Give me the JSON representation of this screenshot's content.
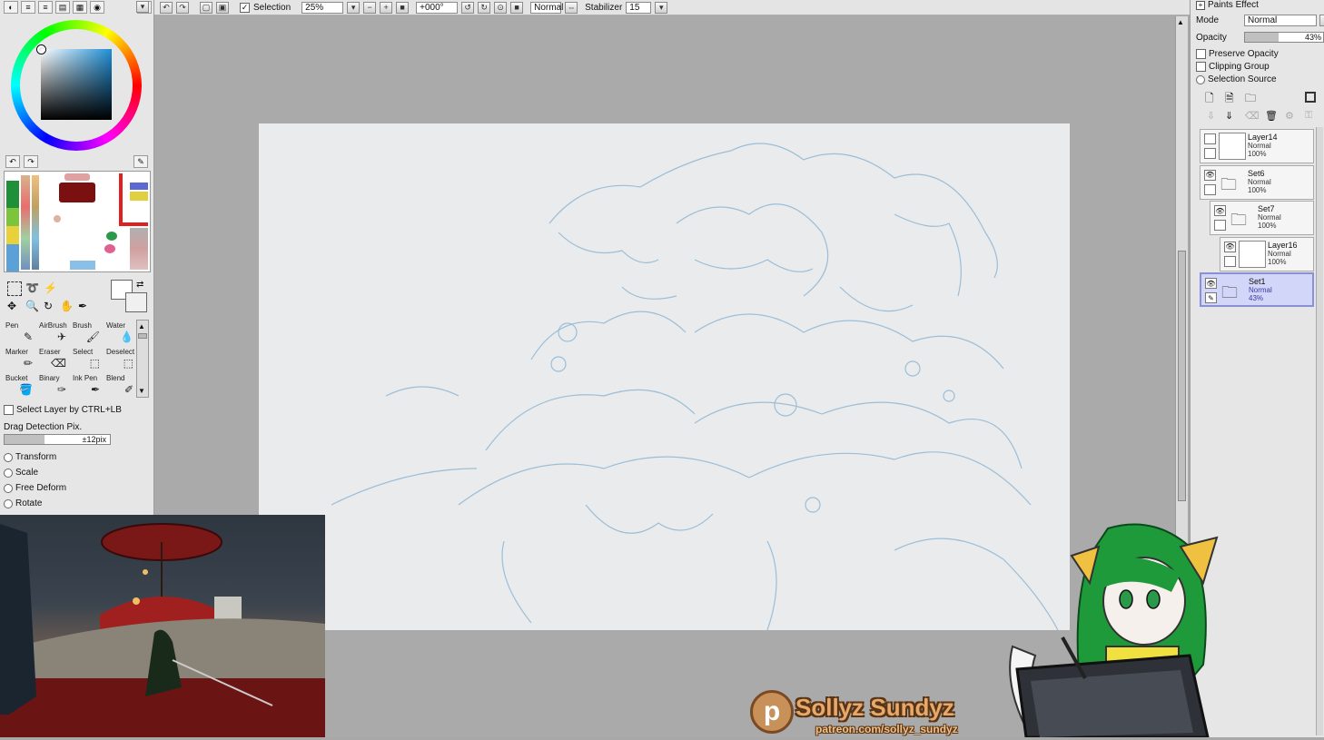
{
  "toolbar": {
    "selection_label": "Selection",
    "zoom": "25%",
    "rotation": "+000°",
    "blend_mode": "Normal",
    "stabilizer_label": "Stabilizer",
    "stabilizer_value": "15"
  },
  "left_panel": {
    "tools": [
      {
        "name": "Pen",
        "icon": "pen-icon"
      },
      {
        "name": "AirBrush",
        "icon": "airbrush-icon"
      },
      {
        "name": "Brush",
        "icon": "brush-icon"
      },
      {
        "name": "Water",
        "icon": "water-icon"
      },
      {
        "name": "Marker",
        "icon": "marker-icon"
      },
      {
        "name": "Eraser",
        "icon": "eraser-icon"
      },
      {
        "name": "Select",
        "icon": "select-icon"
      },
      {
        "name": "Deselect",
        "icon": "deselect-icon"
      },
      {
        "name": "Bucket",
        "icon": "bucket-icon"
      },
      {
        "name": "Binary",
        "icon": "binary-icon"
      },
      {
        "name": "Ink Pen",
        "icon": "ink-pen-icon"
      },
      {
        "name": "Blend",
        "icon": "blend-icon"
      }
    ],
    "select_layer_label": "Select Layer by CTRL+LB",
    "drag_detection_label": "Drag Detection Pix.",
    "drag_detection_value": "±12pix",
    "transform_options": [
      "Transform",
      "Scale",
      "Free Deform",
      "Rotate"
    ]
  },
  "right_panel": {
    "section_title": "Paints Effect",
    "mode_label": "Mode",
    "mode_value": "Normal",
    "opacity_label": "Opacity",
    "opacity_value": "43%",
    "opacity_fraction": 0.43,
    "checkboxes": [
      "Preserve Opacity",
      "Clipping Group",
      "Selection Source"
    ],
    "layers": [
      {
        "name": "Layer14",
        "mode": "Normal",
        "opacity": "100%",
        "type": "layer",
        "indent": 0,
        "visible": false,
        "selected": false
      },
      {
        "name": "Set6",
        "mode": "Normal",
        "opacity": "100%",
        "type": "folder",
        "indent": 0,
        "visible": true,
        "selected": false
      },
      {
        "name": "Set7",
        "mode": "Normal",
        "opacity": "100%",
        "type": "folder",
        "indent": 1,
        "visible": true,
        "selected": false
      },
      {
        "name": "Layer16",
        "mode": "Normal",
        "opacity": "100%",
        "type": "layer",
        "indent": 2,
        "visible": true,
        "selected": false
      },
      {
        "name": "Set1",
        "mode": "Normal",
        "opacity": "43%",
        "type": "folder",
        "indent": 0,
        "visible": true,
        "selected": true
      }
    ]
  },
  "branding": {
    "name": "Sollyz Sundyz",
    "url": "patreon.com/sollyz_sundyz",
    "logo_letter": "p"
  },
  "colors": {
    "selected_layer": "#d2d6f8",
    "sketch_line": "#8fb6d4",
    "brand_orange": "#e7a96b"
  }
}
